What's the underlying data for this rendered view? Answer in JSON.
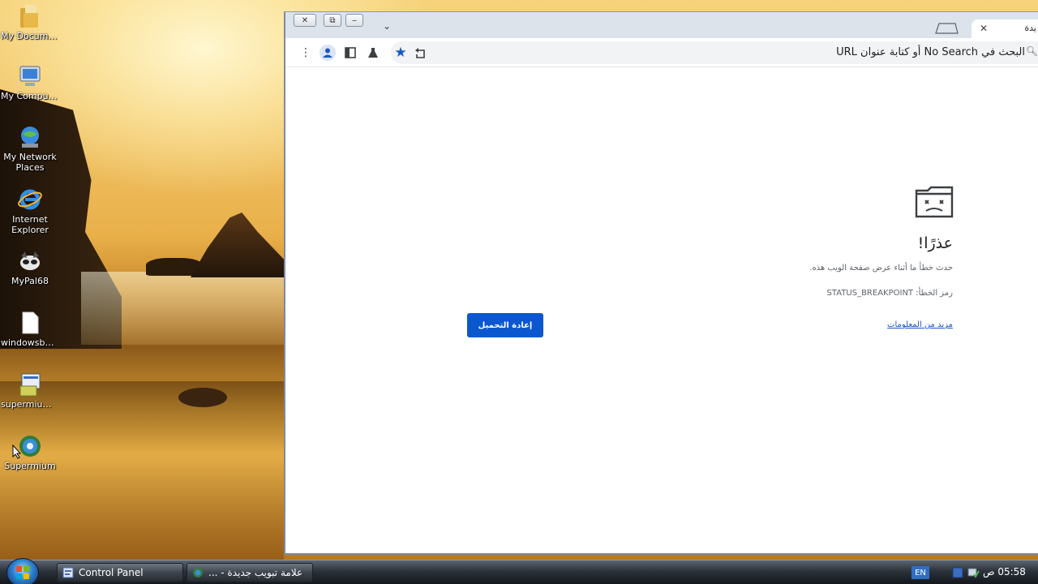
{
  "desktop": {
    "icons": [
      {
        "label": "My Documents",
        "icon": "folder-documents-icon"
      },
      {
        "label": "My Computer",
        "icon": "computer-icon"
      },
      {
        "label": "My Network Places",
        "icon": "network-globe-icon"
      },
      {
        "label": "Internet Explorer",
        "icon": "internet-explorer-icon"
      },
      {
        "label": "MyPal68",
        "icon": "raccoon-icon"
      },
      {
        "label": "windowsboo...",
        "icon": "blank-file-icon"
      },
      {
        "label": "supermium_...",
        "icon": "installer-icon"
      },
      {
        "label": "Supermium",
        "icon": "supermium-globe-icon"
      }
    ]
  },
  "browser": {
    "tab_title": "يدة",
    "omnibox": {
      "placeholder": "البحث في No Search أو كتابة عنوان URL"
    },
    "error_page": {
      "title": "عذرًا!",
      "message": "حدث خطأ ما أثناء عرض صفحة الويب هذه.",
      "error_code_label": "رمز الخطأ: STATUS_BREAKPOINT",
      "more_info_link": "مزيد من المعلومات",
      "reload_button": "إعادة التحميل"
    }
  },
  "taskbar": {
    "tasks": [
      {
        "label": "Control Panel"
      },
      {
        "label": "علامة تبويب جديدة - ..."
      }
    ],
    "language": "EN",
    "clock": "05:58 ص"
  },
  "colors": {
    "accent": "#0b57d0",
    "link": "#1a56c5",
    "star": "#1a56c5"
  }
}
